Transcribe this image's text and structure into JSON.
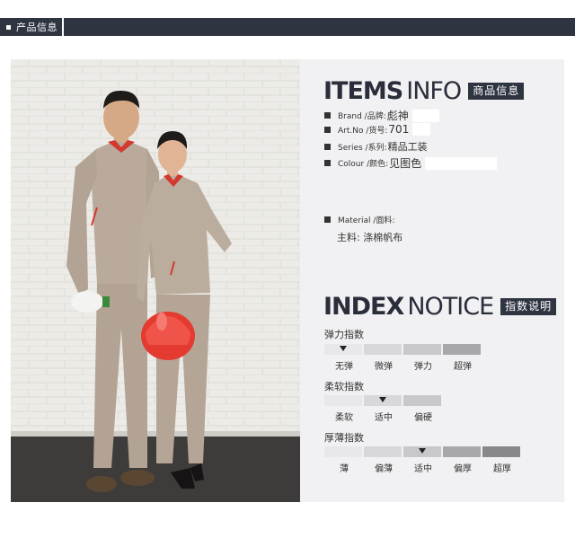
{
  "header": {
    "tab_label": "产品信息"
  },
  "items_info": {
    "title_bold": "ITEMS",
    "title_thin": "INFO",
    "badge": "商品信息",
    "brand_label": "Brand /品牌:",
    "brand_value": "彪神",
    "art_label": "Art.No /货号:",
    "art_value": "701",
    "series_label": "Series /系列:",
    "series_value": "精品工装",
    "colour_label": "Colour /颜色:",
    "colour_value": "见图色",
    "material_label": "Material /面料:",
    "material_value": "主料: 涤棉帆布"
  },
  "index_notice": {
    "title_bold": "INDEX",
    "title_thin": "NOTICE",
    "badge": "指数说明",
    "elasticity": {
      "title": "弹力指数",
      "levels": [
        "无弹",
        "微弹",
        "弹力",
        "超弹"
      ],
      "selected": 0
    },
    "softness": {
      "title": "柔软指数",
      "levels": [
        "柔软",
        "适中",
        "偏硬"
      ],
      "selected": 1
    },
    "thickness": {
      "title": "厚薄指数",
      "levels": [
        "薄",
        "偏薄",
        "适中",
        "偏厚",
        "超厚"
      ],
      "selected": 2
    }
  },
  "colors": {
    "header_bg": "#2f3441",
    "panel_bg": "#f1f1f3",
    "uniform": "#b8a89a",
    "collar": "#d23a2f",
    "helmet": "#e53a30"
  }
}
